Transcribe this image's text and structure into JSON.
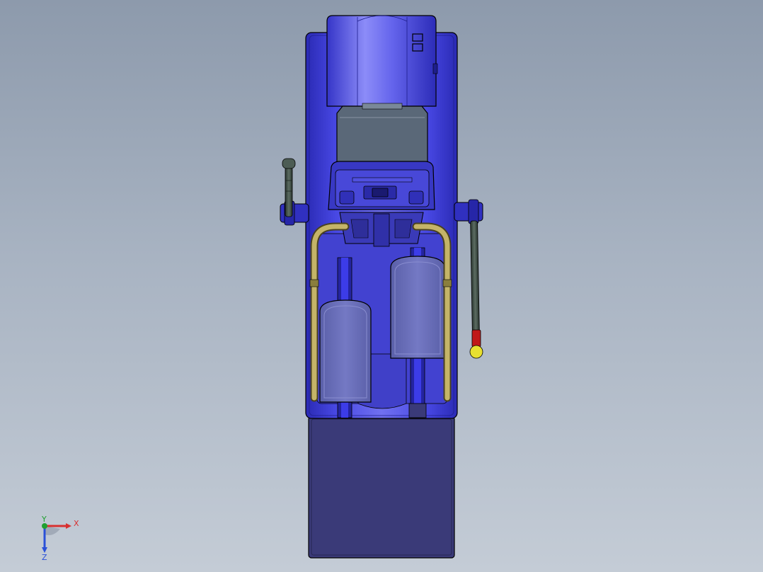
{
  "viewport": {
    "background_top": "#8d9aac",
    "background_bottom": "#c4ccd6",
    "model_colors": {
      "body": "#3f3fdc",
      "body_light": "#6c6cf0",
      "body_dark": "#1e1e8c",
      "panel": "#5a6878",
      "pad": "#6b70b8",
      "tray": "#3a3a78",
      "rail": "#b8a85a",
      "handle_grip": "#3c4a44",
      "handle_tip_red": "#c01818",
      "handle_tip_yellow": "#e8e030",
      "edge": "#000000"
    }
  },
  "triad": {
    "x_label": "X",
    "y_label": "Y",
    "z_label": "Z",
    "x_color": "#d83030",
    "y_color": "#20a030",
    "z_color": "#2a50d8"
  }
}
